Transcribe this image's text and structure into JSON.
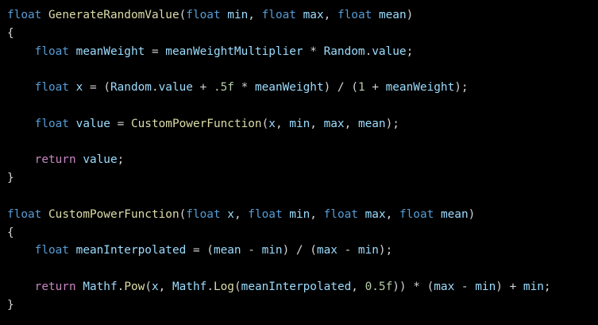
{
  "colors": {
    "background": "#000000",
    "keyword": "#569cd6",
    "function": "#dcdcaa",
    "variable": "#9cdcfe",
    "number": "#b5cea8",
    "control": "#c586c0",
    "plain": "#d4d4d4"
  },
  "code": {
    "lines": [
      [
        {
          "t": "kw",
          "v": "float"
        },
        {
          "t": "plain",
          "v": " "
        },
        {
          "t": "fn",
          "v": "GenerateRandomValue"
        },
        {
          "t": "plain",
          "v": "("
        },
        {
          "t": "kw",
          "v": "float"
        },
        {
          "t": "plain",
          "v": " "
        },
        {
          "t": "var",
          "v": "min"
        },
        {
          "t": "plain",
          "v": ", "
        },
        {
          "t": "kw",
          "v": "float"
        },
        {
          "t": "plain",
          "v": " "
        },
        {
          "t": "var",
          "v": "max"
        },
        {
          "t": "plain",
          "v": ", "
        },
        {
          "t": "kw",
          "v": "float"
        },
        {
          "t": "plain",
          "v": " "
        },
        {
          "t": "var",
          "v": "mean"
        },
        {
          "t": "plain",
          "v": ")"
        }
      ],
      [
        {
          "t": "plain",
          "v": "{"
        }
      ],
      [
        {
          "t": "plain",
          "v": "    "
        },
        {
          "t": "kw",
          "v": "float"
        },
        {
          "t": "plain",
          "v": " "
        },
        {
          "t": "var",
          "v": "meanWeight"
        },
        {
          "t": "plain",
          "v": " = "
        },
        {
          "t": "var",
          "v": "meanWeightMultiplier"
        },
        {
          "t": "plain",
          "v": " * "
        },
        {
          "t": "var",
          "v": "Random"
        },
        {
          "t": "plain",
          "v": "."
        },
        {
          "t": "var",
          "v": "value"
        },
        {
          "t": "plain",
          "v": ";"
        }
      ],
      [],
      [
        {
          "t": "plain",
          "v": "    "
        },
        {
          "t": "kw",
          "v": "float"
        },
        {
          "t": "plain",
          "v": " "
        },
        {
          "t": "var",
          "v": "x"
        },
        {
          "t": "plain",
          "v": " = ("
        },
        {
          "t": "var",
          "v": "Random"
        },
        {
          "t": "plain",
          "v": "."
        },
        {
          "t": "var",
          "v": "value"
        },
        {
          "t": "plain",
          "v": " + "
        },
        {
          "t": "num",
          "v": ".5f"
        },
        {
          "t": "plain",
          "v": " * "
        },
        {
          "t": "var",
          "v": "meanWeight"
        },
        {
          "t": "plain",
          "v": ") / ("
        },
        {
          "t": "num",
          "v": "1"
        },
        {
          "t": "plain",
          "v": " + "
        },
        {
          "t": "var",
          "v": "meanWeight"
        },
        {
          "t": "plain",
          "v": ");"
        }
      ],
      [],
      [
        {
          "t": "plain",
          "v": "    "
        },
        {
          "t": "kw",
          "v": "float"
        },
        {
          "t": "plain",
          "v": " "
        },
        {
          "t": "var",
          "v": "value"
        },
        {
          "t": "plain",
          "v": " = "
        },
        {
          "t": "fn",
          "v": "CustomPowerFunction"
        },
        {
          "t": "plain",
          "v": "("
        },
        {
          "t": "var",
          "v": "x"
        },
        {
          "t": "plain",
          "v": ", "
        },
        {
          "t": "var",
          "v": "min"
        },
        {
          "t": "plain",
          "v": ", "
        },
        {
          "t": "var",
          "v": "max"
        },
        {
          "t": "plain",
          "v": ", "
        },
        {
          "t": "var",
          "v": "mean"
        },
        {
          "t": "plain",
          "v": ");"
        }
      ],
      [],
      [
        {
          "t": "plain",
          "v": "    "
        },
        {
          "t": "ctl",
          "v": "return"
        },
        {
          "t": "plain",
          "v": " "
        },
        {
          "t": "var",
          "v": "value"
        },
        {
          "t": "plain",
          "v": ";"
        }
      ],
      [
        {
          "t": "plain",
          "v": "}"
        }
      ],
      [],
      [
        {
          "t": "kw",
          "v": "float"
        },
        {
          "t": "plain",
          "v": " "
        },
        {
          "t": "fn",
          "v": "CustomPowerFunction"
        },
        {
          "t": "plain",
          "v": "("
        },
        {
          "t": "kw",
          "v": "float"
        },
        {
          "t": "plain",
          "v": " "
        },
        {
          "t": "var",
          "v": "x"
        },
        {
          "t": "plain",
          "v": ", "
        },
        {
          "t": "kw",
          "v": "float"
        },
        {
          "t": "plain",
          "v": " "
        },
        {
          "t": "var",
          "v": "min"
        },
        {
          "t": "plain",
          "v": ", "
        },
        {
          "t": "kw",
          "v": "float"
        },
        {
          "t": "plain",
          "v": " "
        },
        {
          "t": "var",
          "v": "max"
        },
        {
          "t": "plain",
          "v": ", "
        },
        {
          "t": "kw",
          "v": "float"
        },
        {
          "t": "plain",
          "v": " "
        },
        {
          "t": "var",
          "v": "mean"
        },
        {
          "t": "plain",
          "v": ")"
        }
      ],
      [
        {
          "t": "plain",
          "v": "{"
        }
      ],
      [
        {
          "t": "plain",
          "v": "    "
        },
        {
          "t": "kw",
          "v": "float"
        },
        {
          "t": "plain",
          "v": " "
        },
        {
          "t": "var",
          "v": "meanInterpolated"
        },
        {
          "t": "plain",
          "v": " = ("
        },
        {
          "t": "var",
          "v": "mean"
        },
        {
          "t": "plain",
          "v": " - "
        },
        {
          "t": "var",
          "v": "min"
        },
        {
          "t": "plain",
          "v": ") / ("
        },
        {
          "t": "var",
          "v": "max"
        },
        {
          "t": "plain",
          "v": " - "
        },
        {
          "t": "var",
          "v": "min"
        },
        {
          "t": "plain",
          "v": ");"
        }
      ],
      [],
      [
        {
          "t": "plain",
          "v": "    "
        },
        {
          "t": "ctl",
          "v": "return"
        },
        {
          "t": "plain",
          "v": " "
        },
        {
          "t": "var",
          "v": "Mathf"
        },
        {
          "t": "plain",
          "v": "."
        },
        {
          "t": "fn",
          "v": "Pow"
        },
        {
          "t": "plain",
          "v": "("
        },
        {
          "t": "var",
          "v": "x"
        },
        {
          "t": "plain",
          "v": ", "
        },
        {
          "t": "var",
          "v": "Mathf"
        },
        {
          "t": "plain",
          "v": "."
        },
        {
          "t": "fn",
          "v": "Log"
        },
        {
          "t": "plain",
          "v": "("
        },
        {
          "t": "var",
          "v": "meanInterpolated"
        },
        {
          "t": "plain",
          "v": ", "
        },
        {
          "t": "num",
          "v": "0.5f"
        },
        {
          "t": "plain",
          "v": ")) * ("
        },
        {
          "t": "var",
          "v": "max"
        },
        {
          "t": "plain",
          "v": " - "
        },
        {
          "t": "var",
          "v": "min"
        },
        {
          "t": "plain",
          "v": ") + "
        },
        {
          "t": "var",
          "v": "min"
        },
        {
          "t": "plain",
          "v": ";"
        }
      ],
      [
        {
          "t": "plain",
          "v": "}"
        }
      ]
    ]
  }
}
